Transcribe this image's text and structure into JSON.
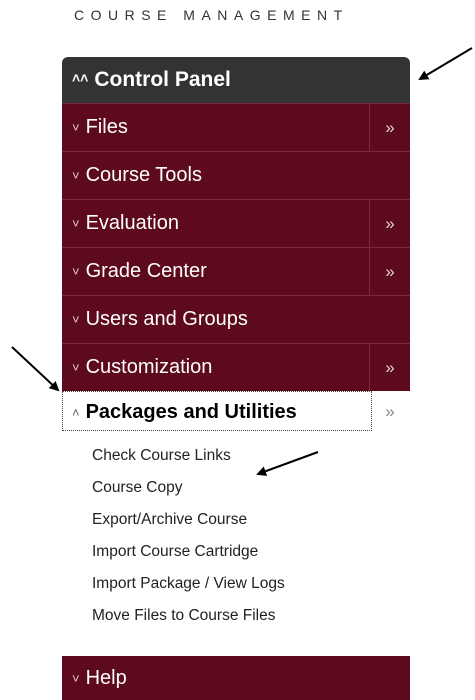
{
  "heading": "COURSE MANAGEMENT",
  "control_panel": {
    "label": "Control Panel",
    "icon": "chevron-up-icon"
  },
  "menu_items": [
    {
      "label": "Files",
      "has_submenu": true
    },
    {
      "label": "Course Tools",
      "has_submenu": false
    },
    {
      "label": "Evaluation",
      "has_submenu": true
    },
    {
      "label": "Grade Center",
      "has_submenu": true
    },
    {
      "label": "Users and Groups",
      "has_submenu": false
    },
    {
      "label": "Customization",
      "has_submenu": true
    }
  ],
  "active_item": {
    "label": "Packages and Utilities",
    "subitems": [
      "Check Course Links",
      "Course Copy",
      "Export/Archive Course",
      "Import Course Cartridge",
      "Import Package / View Logs",
      "Move Files to Course Files"
    ]
  },
  "help": {
    "label": "Help"
  },
  "glyphs": {
    "collapsed": "≽",
    "expanded": "≼",
    "more": "»"
  },
  "colors": {
    "header_bg": "#333333",
    "item_bg": "#5c0a1c"
  }
}
